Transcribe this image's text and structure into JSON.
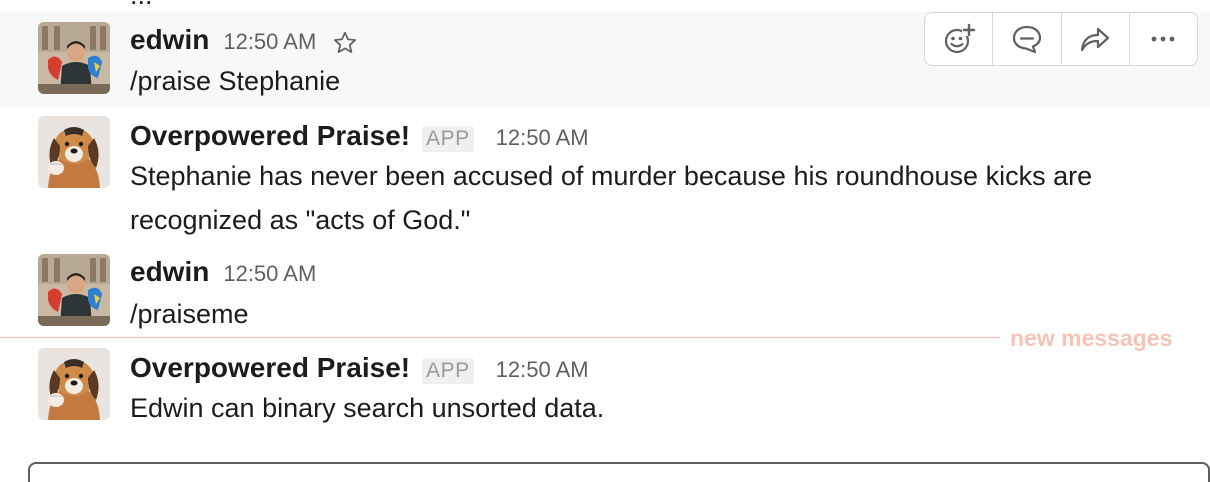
{
  "clipped_previous_line": "...",
  "messages": [
    {
      "author": "edwin",
      "time": "12:50 AM",
      "text": "/praise Stephanie",
      "avatar": "user-photo-with-parrot",
      "hovered": true
    },
    {
      "author": "Overpowered Praise!",
      "badge": "APP",
      "time": "12:50 AM",
      "text": "Stephanie has never been accused of murder because his roundhouse kicks are recognized as \"acts of God.\"",
      "avatar": "puppy-bot-avatar"
    },
    {
      "author": "edwin",
      "time": "12:50 AM",
      "text": "/praiseme",
      "avatar": "user-photo-with-parrot"
    },
    {
      "author": "Overpowered Praise!",
      "badge": "APP",
      "time": "12:50 AM",
      "text": "Edwin can binary search unsorted data.",
      "avatar": "puppy-bot-avatar"
    }
  ],
  "hover_toolbar": {
    "actions": [
      "add-reaction-icon",
      "reply-thread-icon",
      "share-icon",
      "more-actions-icon"
    ]
  },
  "divider": {
    "label": "new messages",
    "color": "#f4b9ad"
  },
  "colors": {
    "hover_bg": "#f8f8f8",
    "text": "#1d1c1d",
    "muted": "#616061"
  }
}
